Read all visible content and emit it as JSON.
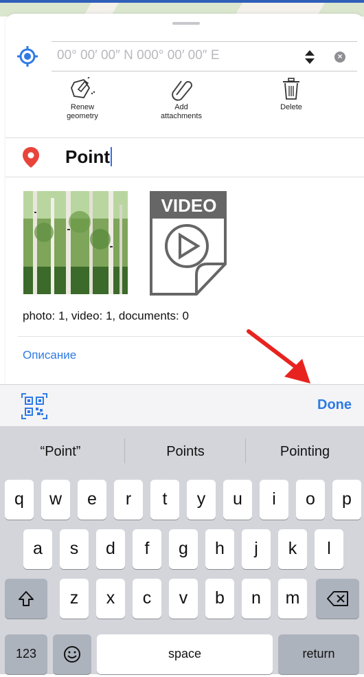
{
  "coords": {
    "placeholder": "00° 00′ 00″ N 000° 00′ 00″ E"
  },
  "toolbar": [
    {
      "label": "Renew\ngeometry",
      "icon": "renew-geometry-icon"
    },
    {
      "label": "Add\nattachments",
      "icon": "paperclip-icon"
    },
    {
      "label": "Delete",
      "icon": "trash-icon"
    }
  ],
  "feature": {
    "name": "Point"
  },
  "attachments": {
    "video_label": "VIDEO",
    "summary": "photo: 1, video: 1, documents: 0"
  },
  "description_link": "Описание",
  "accessory": {
    "done_label": "Done",
    "qr_icon": "qr-code-icon"
  },
  "suggestions": [
    "“Point”",
    "Points",
    "Pointing"
  ],
  "keyboard": {
    "row1": [
      "q",
      "w",
      "e",
      "r",
      "t",
      "y",
      "u",
      "i",
      "o",
      "p"
    ],
    "row2": [
      "a",
      "s",
      "d",
      "f",
      "g",
      "h",
      "j",
      "k",
      "l"
    ],
    "row3": [
      "z",
      "x",
      "c",
      "v",
      "b",
      "n",
      "m"
    ],
    "numbers": "123",
    "space": "space",
    "return": "return"
  },
  "colors": {
    "accent": "#2f7ae5",
    "pin": "#e8443a"
  }
}
